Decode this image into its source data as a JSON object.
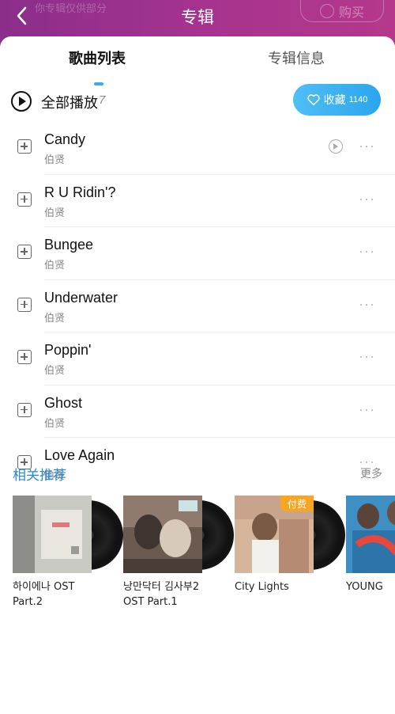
{
  "header": {
    "title": "专辑",
    "buy_label": "购买",
    "ghost_text": "你专辑仅供部分"
  },
  "tabs": [
    {
      "label": "歌曲列表",
      "active": true
    },
    {
      "label": "专辑信息",
      "active": false
    }
  ],
  "play_all": {
    "label": "全部播放",
    "count": "7"
  },
  "favorite": {
    "label": "收藏",
    "count": "1140"
  },
  "songs": [
    {
      "title": "Candy",
      "artist": "伯贤",
      "has_mv": true
    },
    {
      "title": "R U Ridin'?",
      "artist": "伯贤",
      "has_mv": false
    },
    {
      "title": "Bungee",
      "artist": "伯贤",
      "has_mv": false
    },
    {
      "title": "Underwater",
      "artist": "伯贤",
      "has_mv": false
    },
    {
      "title": "Poppin'",
      "artist": "伯贤",
      "has_mv": false
    },
    {
      "title": "Ghost",
      "artist": "伯贤",
      "has_mv": false
    },
    {
      "title": "Love Again",
      "artist": "伯贤",
      "has_mv": false
    }
  ],
  "recommend": {
    "title": "相关推荐",
    "more_label": "更多",
    "items": [
      {
        "name": "하이에나 OST Part.2",
        "paid": false
      },
      {
        "name": "낭만닥터 김사부2 OST Part.1",
        "paid": false
      },
      {
        "name": "City Lights",
        "paid": true,
        "badge": "付费"
      },
      {
        "name": "YOUNG",
        "paid": false
      }
    ]
  },
  "colors": {
    "header": "#a5338f",
    "accent_blue": "#2aa6ee",
    "rec_title": "#2a8ad0",
    "paid_badge": "#f5a623"
  }
}
